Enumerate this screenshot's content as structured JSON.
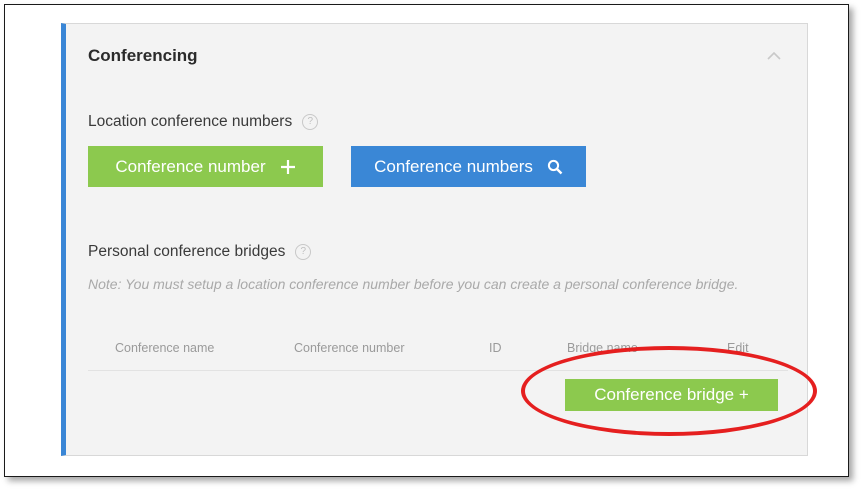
{
  "section": {
    "title": "Conferencing"
  },
  "location": {
    "heading": "Location conference numbers",
    "help": "?",
    "add_button_label": "Conference number",
    "search_button_label": "Conference numbers"
  },
  "personal": {
    "heading": "Personal conference bridges",
    "help": "?",
    "note": "Note: You must setup a location conference number before you can create a personal conference bridge.",
    "columns": [
      "Conference name",
      "Conference number",
      "ID",
      "Bridge name",
      "Edit"
    ],
    "add_bridge_label": "Conference bridge +"
  },
  "colors": {
    "accent_green": "#8cc94e",
    "accent_blue": "#3a87d6",
    "highlight_red": "#e51f1f",
    "panel_border_blue": "#3a86d6"
  }
}
